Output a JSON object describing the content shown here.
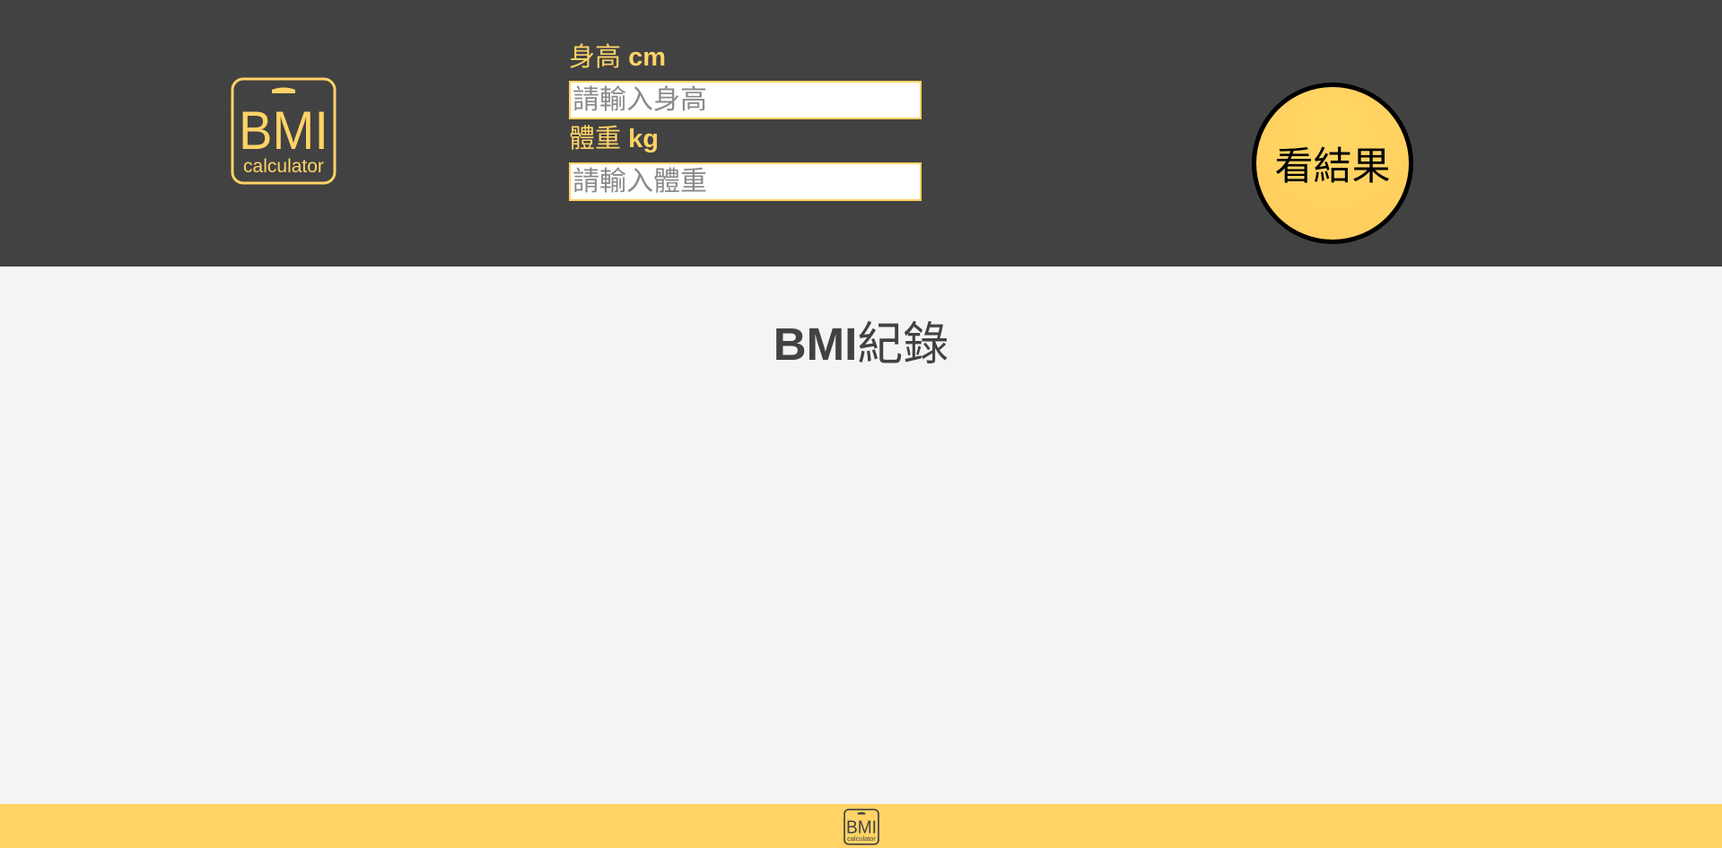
{
  "header": {
    "logo": {
      "icon": "bmi-calculator-logo",
      "text_main": "BMI",
      "text_sub": "calculator",
      "color": "#ffd366"
    },
    "height_field": {
      "label": "身高",
      "unit": "cm",
      "placeholder": "請輸入身高",
      "value": ""
    },
    "weight_field": {
      "label": "體重",
      "unit": "kg",
      "placeholder": "請輸入體重",
      "value": ""
    },
    "result_button": {
      "label": "看結果"
    }
  },
  "main": {
    "title_bmi": "BMI",
    "title_suffix": "紀錄"
  },
  "footer": {
    "logo": {
      "icon": "bmi-calculator-logo",
      "text_main": "BMI",
      "text_sub": "calculator",
      "color": "#424242"
    }
  },
  "colors": {
    "header_bg": "#424242",
    "accent": "#ffd366",
    "page_bg": "#f4f4f4",
    "footer_bg": "#ffd366"
  }
}
